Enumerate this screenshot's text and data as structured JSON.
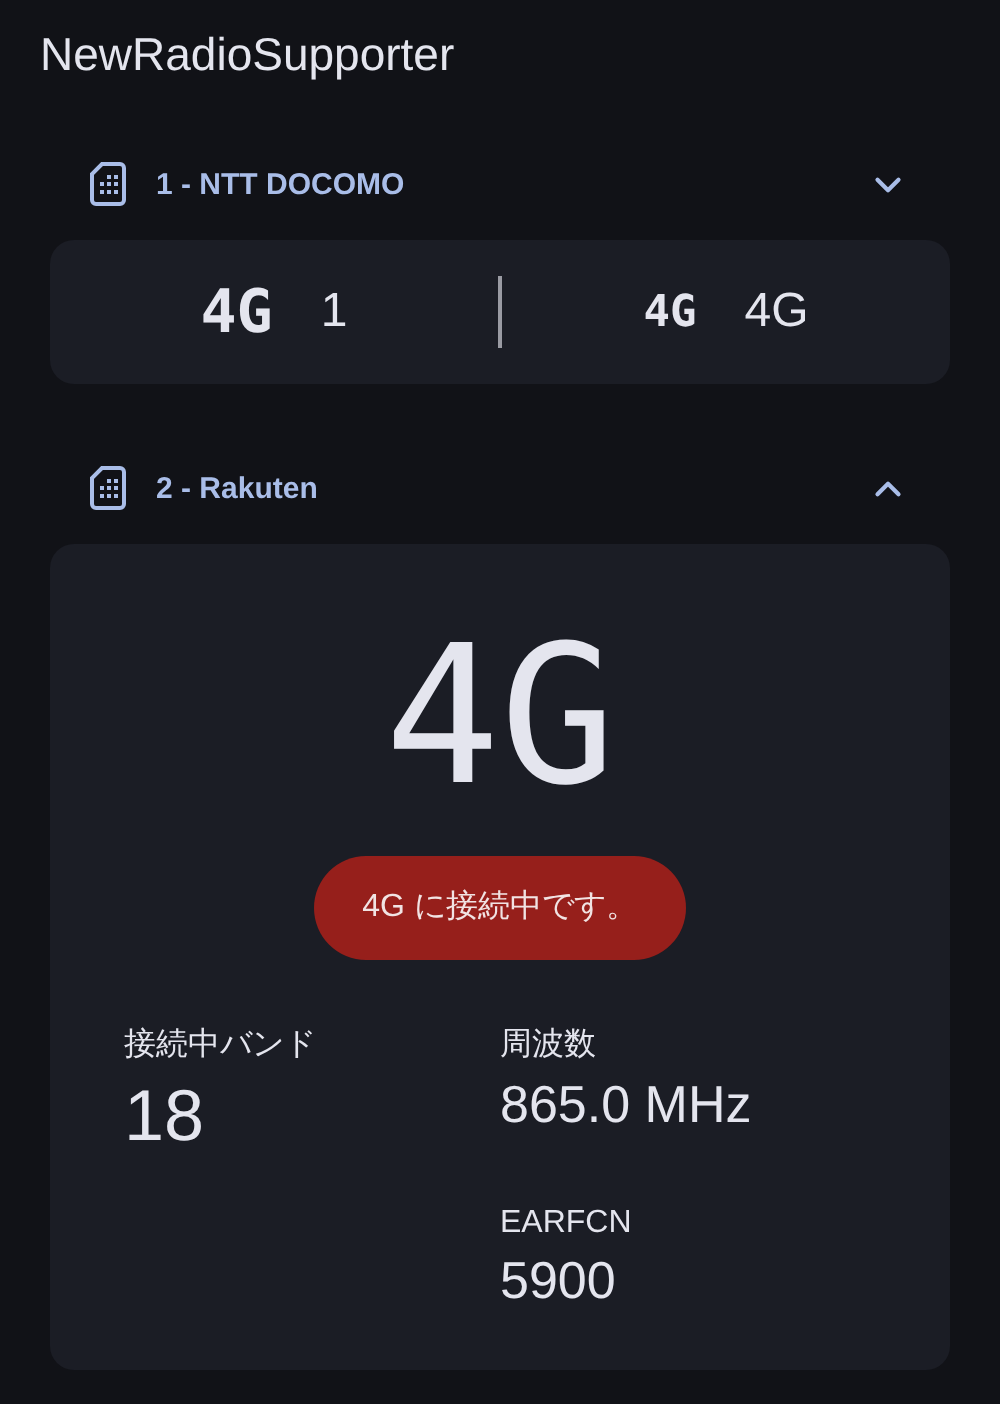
{
  "app_title": "NewRadioSupporter",
  "sims": [
    {
      "title": "1 - NTT DOCOMO",
      "expanded": false,
      "summary": [
        {
          "network": "4G",
          "value": "1"
        },
        {
          "network": "4G",
          "value": "4G"
        }
      ]
    },
    {
      "title": "2 - Rakuten",
      "expanded": true,
      "network": "4G",
      "status": "4G に接続中です。",
      "fields": [
        {
          "label": "接続中バンド",
          "value": "18"
        },
        {
          "label": "周波数",
          "value": "865.0 MHz"
        },
        {
          "label": "EARFCN",
          "value": "5900"
        }
      ]
    }
  ]
}
